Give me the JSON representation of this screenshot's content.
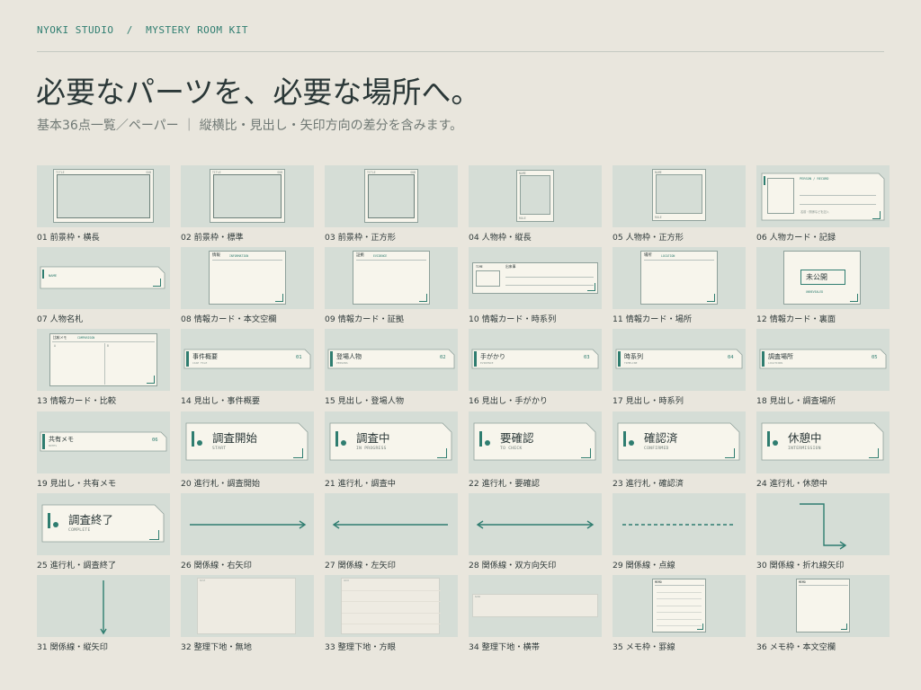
{
  "header": {
    "breadcrumb": "NYOKI STUDIO  /  MYSTERY ROOM KIT",
    "title": "必要なパーツを、必要な場所へ。",
    "subtitle": "基本36点一覧／ペーパー ｜ 縦横比・見出し・矢印方向の差分を含みます。"
  },
  "colors": {
    "accent": "#2f7d70",
    "background": "#e9e6dd",
    "thumb": "#d5ddd6",
    "paper": "#f7f5ec"
  },
  "items": [
    {
      "label": "01 前景枠・横長",
      "kind": "frame",
      "variant": "wide",
      "tags": [
        "TITLE",
        "SUB"
      ]
    },
    {
      "label": "02 前景枠・標準",
      "kind": "frame",
      "variant": "std",
      "tags": [
        "TITLE",
        "SUB"
      ]
    },
    {
      "label": "03 前景枠・正方形",
      "kind": "frame",
      "variant": "square",
      "tags": [
        "TITLE",
        "SUB"
      ]
    },
    {
      "label": "04 人物枠・縦長",
      "kind": "person",
      "variant": "tall",
      "tags": [
        "NAME",
        "ROLE"
      ]
    },
    {
      "label": "05 人物枠・正方形",
      "kind": "person",
      "variant": "square",
      "tags": [
        "NAME",
        "ROLE"
      ]
    },
    {
      "label": "06 人物カード・記録",
      "kind": "record",
      "head": "PERSON / RECORD",
      "note": "名前・関係などを記入"
    },
    {
      "label": "07 人物名札",
      "kind": "nametag",
      "tag": "NAME"
    },
    {
      "label": "08 情報カード・本文空欄",
      "kind": "info",
      "head": "情報",
      "sub": "INFORMATION"
    },
    {
      "label": "09 情報カード・証拠",
      "kind": "info",
      "head": "証拠",
      "sub": "EVIDENCE"
    },
    {
      "label": "10 情報カード・時系列",
      "kind": "timeline",
      "tag": "TIME",
      "head": "出来事"
    },
    {
      "label": "11 情報カード・場所",
      "kind": "info",
      "head": "場所",
      "sub": "LOCATION"
    },
    {
      "label": "12 情報カード・裏面",
      "kind": "back",
      "text": "未公開",
      "sub": "UNREVEALED"
    },
    {
      "label": "13 情報カード・比較",
      "kind": "compare",
      "head": "比較メモ",
      "sub": "COMPARISON",
      "a": "A",
      "b": "B"
    },
    {
      "label": "14 見出し・事件概要",
      "kind": "heading",
      "text": "事件概要",
      "sub": "CASE FILE",
      "num": "01"
    },
    {
      "label": "15 見出し・登場人物",
      "kind": "heading",
      "text": "登場人物",
      "sub": "PERSONS",
      "num": "02"
    },
    {
      "label": "16 見出し・手がかり",
      "kind": "heading",
      "text": "手がかり",
      "sub": "EVIDENCE",
      "num": "03"
    },
    {
      "label": "17 見出し・時系列",
      "kind": "heading",
      "text": "時系列",
      "sub": "TIMELINE",
      "num": "04"
    },
    {
      "label": "18 見出し・調査場所",
      "kind": "heading",
      "text": "調査場所",
      "sub": "LOCATIONS",
      "num": "05"
    },
    {
      "label": "19 見出し・共有メモ",
      "kind": "heading",
      "text": "共有メモ",
      "sub": "NOTES",
      "num": "06"
    },
    {
      "label": "20 進行札・調査開始",
      "kind": "status",
      "text": "調査開始",
      "sub": "START"
    },
    {
      "label": "21 進行札・調査中",
      "kind": "status",
      "text": "調査中",
      "sub": "IN PROGRESS"
    },
    {
      "label": "22 進行札・要確認",
      "kind": "status",
      "text": "要確認",
      "sub": "TO CHECK"
    },
    {
      "label": "23 進行札・確認済",
      "kind": "status",
      "text": "確認済",
      "sub": "CONFIRMED"
    },
    {
      "label": "24 進行札・休憩中",
      "kind": "status",
      "text": "休憩中",
      "sub": "INTERMISSION"
    },
    {
      "label": "25 進行札・調査終了",
      "kind": "status",
      "text": "調査終了",
      "sub": "COMPLETE"
    },
    {
      "label": "26 関係線・右矢印",
      "kind": "arrow",
      "variant": "right"
    },
    {
      "label": "27 関係線・左矢印",
      "kind": "arrow",
      "variant": "left"
    },
    {
      "label": "28 関係線・双方向矢印",
      "kind": "arrow",
      "variant": "both"
    },
    {
      "label": "29 関係線・点線",
      "kind": "arrow",
      "variant": "dotted"
    },
    {
      "label": "30 関係線・折れ線矢印",
      "kind": "arrow",
      "variant": "elbow"
    },
    {
      "label": "31 関係線・縦矢印",
      "kind": "arrow",
      "variant": "down"
    },
    {
      "label": "32 整理下地・無地",
      "kind": "base",
      "variant": "plain",
      "tag": "BASE"
    },
    {
      "label": "33 整理下地・方眼",
      "kind": "base",
      "variant": "grid",
      "tag": "GRID"
    },
    {
      "label": "34 整理下地・横帯",
      "kind": "base",
      "variant": "band",
      "tag": "BAND"
    },
    {
      "label": "35 メモ枠・罫線",
      "kind": "memo",
      "variant": "lined",
      "tag": "MEMO"
    },
    {
      "label": "36 メモ枠・本文空欄",
      "kind": "memo",
      "variant": "blank",
      "tag": "MEMO"
    }
  ]
}
